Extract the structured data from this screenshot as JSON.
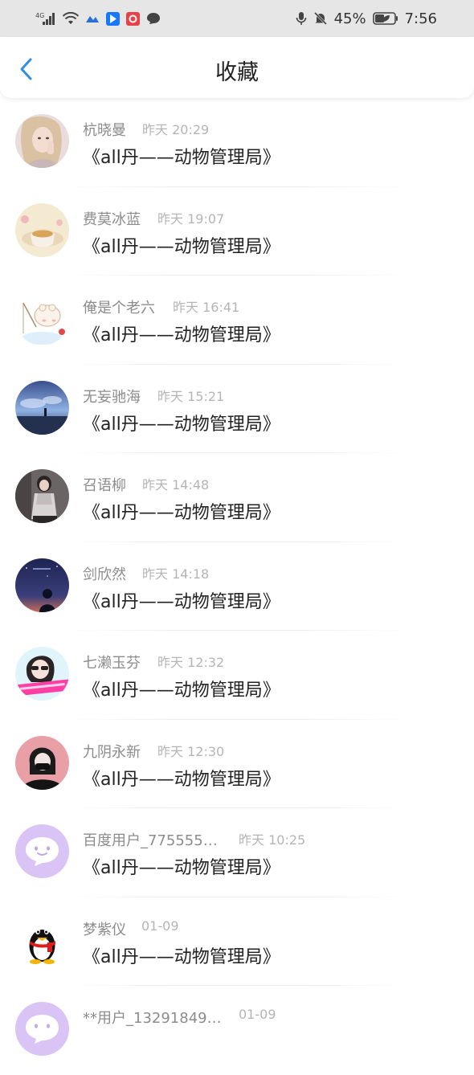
{
  "status_bar": {
    "network": "4G",
    "battery_percent": "45%",
    "time": "7:56"
  },
  "header": {
    "title": "收藏",
    "back_icon": "chevron-left-icon",
    "accent_color": "#2f8ee8"
  },
  "favorites": [
    {
      "user": "杭晓曼",
      "time": "昨天 20:29",
      "content": "《all丹——动物管理局》"
    },
    {
      "user": "费莫冰蓝",
      "time": "昨天 19:07",
      "content": "《all丹——动物管理局》"
    },
    {
      "user": "俺是个老六",
      "time": "昨天 16:41",
      "content": "《all丹——动物管理局》"
    },
    {
      "user": "无妄驰海",
      "time": "昨天 15:21",
      "content": "《all丹——动物管理局》"
    },
    {
      "user": "召语柳",
      "time": "昨天 14:48",
      "content": "《all丹——动物管理局》"
    },
    {
      "user": "剑欣然",
      "time": "昨天 14:18",
      "content": "《all丹——动物管理局》"
    },
    {
      "user": "七濑玉芬",
      "time": "昨天 12:32",
      "content": "《all丹——动物管理局》"
    },
    {
      "user": "九阴永新",
      "time": "昨天 12:30",
      "content": "《all丹——动物管理局》"
    },
    {
      "user": "百度用户_775555…",
      "time": "昨天 10:25",
      "content": "《all丹——动物管理局》"
    },
    {
      "user": "梦紫仪",
      "time": "01-09",
      "content": "《all丹——动物管理局》"
    },
    {
      "user": "**用户_13291849…",
      "time": "01-09",
      "content": ""
    }
  ]
}
